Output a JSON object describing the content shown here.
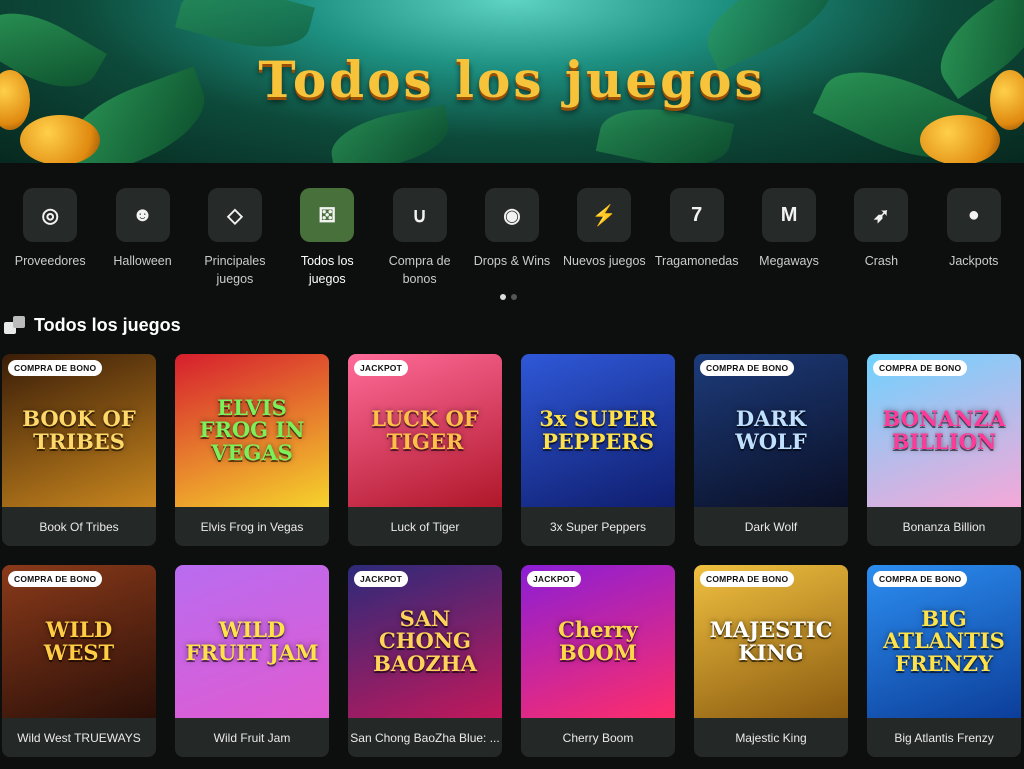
{
  "banner": {
    "title": "Todos los juegos"
  },
  "categories": [
    {
      "label": "Proveedores",
      "icon": "globe-icon",
      "glyph": "◎"
    },
    {
      "label": "Halloween",
      "icon": "pumpkin-icon",
      "glyph": "☻"
    },
    {
      "label": "Principales juegos",
      "icon": "diamond-icon",
      "glyph": "◇"
    },
    {
      "label": "Todos los juegos",
      "icon": "dice-icon",
      "glyph": "⚄",
      "active": true
    },
    {
      "label": "Compra de bonos",
      "icon": "horseshoe-icon",
      "glyph": "∪"
    },
    {
      "label": "Drops & Wins",
      "icon": "drops-wins-icon",
      "glyph": "◉"
    },
    {
      "label": "Nuevos juegos",
      "icon": "lightning-icon",
      "glyph": "⚡"
    },
    {
      "label": "Tragamonedas",
      "icon": "seven-icon",
      "glyph": "7"
    },
    {
      "label": "Megaways",
      "icon": "megaways-icon",
      "glyph": "M"
    },
    {
      "label": "Crash",
      "icon": "rocket-icon",
      "glyph": "➶"
    },
    {
      "label": "Jackpots",
      "icon": "piggy-bank-icon",
      "glyph": "●"
    }
  ],
  "section": {
    "title": "Todos los juegos",
    "icon": "dice-icon"
  },
  "games": [
    {
      "title": "Book Of Tribes",
      "badge": "COMPRA DE BONO",
      "art": "BOOK OF TRIBES",
      "bg": [
        "#3a1d08",
        "#c8861e"
      ],
      "fg": "#ffd86a"
    },
    {
      "title": "Elvis Frog in Vegas",
      "badge": "",
      "art": "ELVIS FROG IN VEGAS",
      "bg": [
        "#d61e2e",
        "#f6d32c"
      ],
      "fg": "#7cf05a"
    },
    {
      "title": "Luck of Tiger",
      "badge": "JACKPOT",
      "art": "LUCK OF TIGER",
      "bg": [
        "#ff6b9a",
        "#b0172a"
      ],
      "fg": "#ffc04a"
    },
    {
      "title": "3x Super Peppers",
      "badge": "",
      "art": "3x SUPER PEPPERS",
      "bg": [
        "#2f58d8",
        "#0f1e6e"
      ],
      "fg": "#ffe14a"
    },
    {
      "title": "Dark Wolf",
      "badge": "COMPRA DE BONO",
      "art": "DARK WOLF",
      "bg": [
        "#1d3b7a",
        "#0a0f25"
      ],
      "fg": "#bfe0ff"
    },
    {
      "title": "Bonanza Billion",
      "badge": "COMPRA DE BONO",
      "art": "BONANZA BILLION",
      "bg": [
        "#6fd2ff",
        "#f5a8d8"
      ],
      "fg": "#ff3b9a"
    },
    {
      "title": "Wild West TRUEWAYS",
      "badge": "COMPRA DE BONO",
      "art": "WILD WEST",
      "bg": [
        "#8a3a1a",
        "#2a0f08"
      ],
      "fg": "#ffcc44"
    },
    {
      "title": "Wild Fruit Jam",
      "badge": "",
      "art": "WILD FRUIT JAM",
      "bg": [
        "#b96cf0",
        "#e05ad0"
      ],
      "fg": "#ffe24a"
    },
    {
      "title": "San Chong BaoZha Blue: ...",
      "badge": "JACKPOT",
      "art": "SAN CHONG BAOZHA",
      "bg": [
        "#2c2a7a",
        "#c2185b"
      ],
      "fg": "#ffd35a"
    },
    {
      "title": "Cherry Boom",
      "badge": "JACKPOT",
      "art": "Cherry BOOM",
      "bg": [
        "#8b1ed6",
        "#ff2d6a"
      ],
      "fg": "#ffd84a"
    },
    {
      "title": "Majestic King",
      "badge": "COMPRA DE BONO",
      "art": "MAJESTIC KING",
      "bg": [
        "#f0c040",
        "#8a5a10"
      ],
      "fg": "#ffffff"
    },
    {
      "title": "Big Atlantis Frenzy",
      "badge": "COMPRA DE BONO",
      "art": "BIG ATLANTIS FRENZY",
      "bg": [
        "#2c8ef0",
        "#0c3e9a"
      ],
      "fg": "#ffe24a"
    }
  ]
}
